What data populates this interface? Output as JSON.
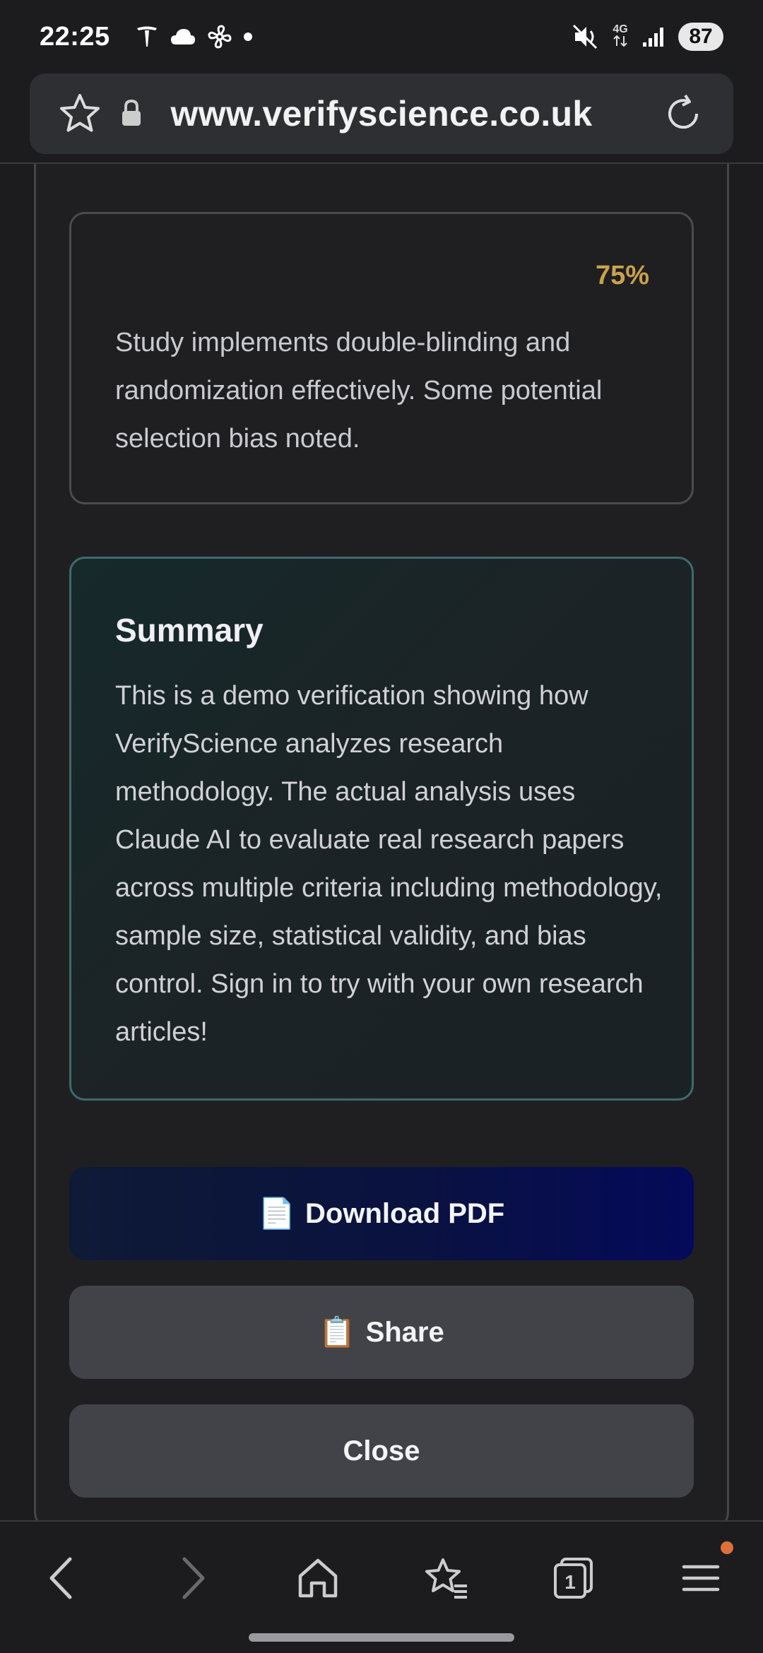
{
  "status_bar": {
    "time": "22:25",
    "network": "4G",
    "battery": "87"
  },
  "url_bar": {
    "url": "www.verifyscience.co.uk"
  },
  "score_card": {
    "percentage": "75%",
    "text": "Study implements double-blinding and randomization effectively. Some potential selection bias noted."
  },
  "summary_card": {
    "title": "Summary",
    "text": "This is a demo verification showing how VerifyScience analyzes research methodology. The actual analysis uses Claude AI to evaluate real research papers across multiple criteria including methodology, sample size, statistical validity, and bias control. Sign in to try with your own research articles!"
  },
  "buttons": {
    "download_pdf": {
      "emoji": "📄",
      "label": "Download PDF"
    },
    "share": {
      "emoji": "📋",
      "label": "Share"
    },
    "close": {
      "label": "Close"
    }
  },
  "nav": {
    "tabs_count": "1"
  },
  "colors": {
    "accent_score": "#c9a24a",
    "summary_border": "#3f6a6b",
    "pdf_button": "#0a1240",
    "notification_dot": "#e0703a"
  }
}
